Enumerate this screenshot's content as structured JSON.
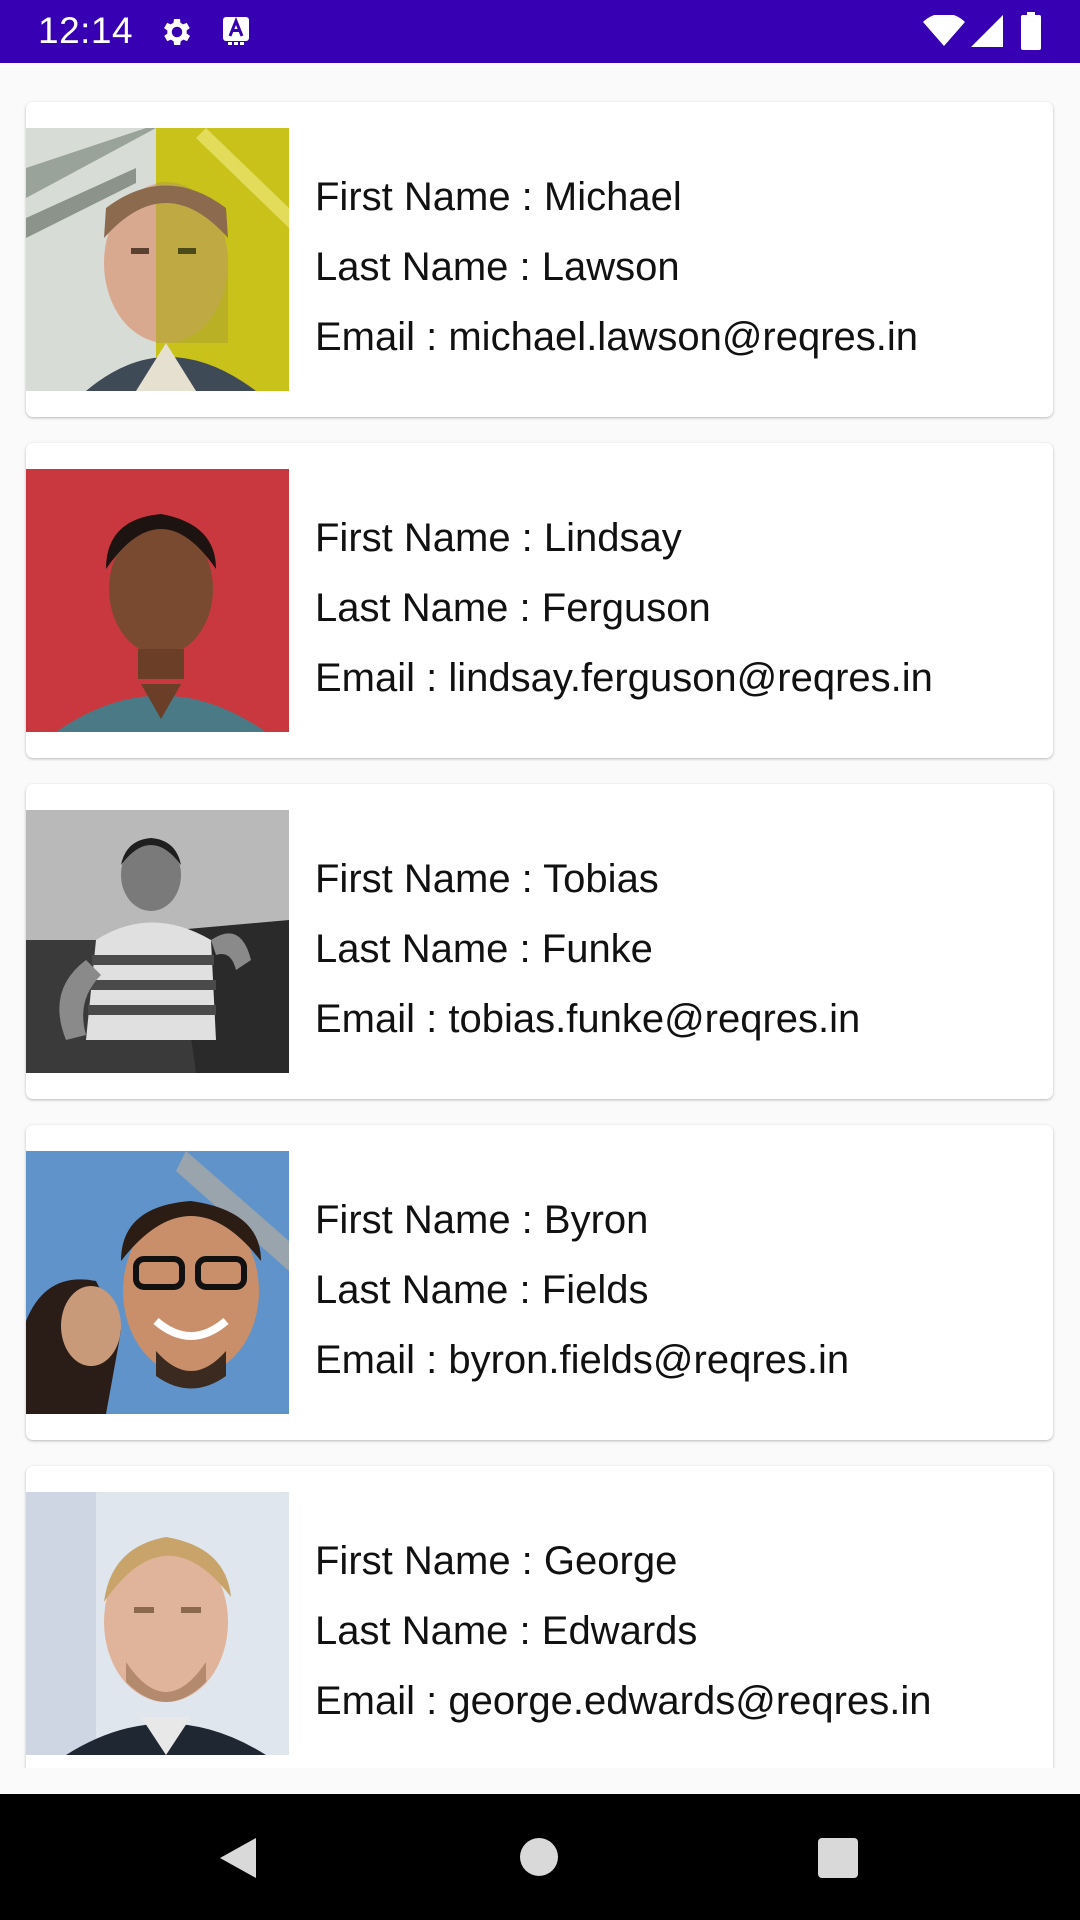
{
  "status_bar": {
    "time": "12:14",
    "background_color": "#3700b3",
    "icons": [
      "gear-icon",
      "keyboard-a-icon",
      "wifi-icon",
      "signal-icon",
      "battery-icon"
    ]
  },
  "users": [
    {
      "first_name_label": "First Name : Michael",
      "last_name_label": "Last Name : Lawson",
      "email_label": "Email : michael.lawson@reqres.in",
      "avatar": "michael-lawson-avatar"
    },
    {
      "first_name_label": "First Name : Lindsay",
      "last_name_label": "Last Name : Ferguson",
      "email_label": "Email : lindsay.ferguson@reqres.in",
      "avatar": "lindsay-ferguson-avatar"
    },
    {
      "first_name_label": "First Name : Tobias",
      "last_name_label": "Last Name : Funke",
      "email_label": "Email : tobias.funke@reqres.in",
      "avatar": "tobias-funke-avatar"
    },
    {
      "first_name_label": "First Name : Byron",
      "last_name_label": "Last Name : Fields",
      "email_label": "Email : byron.fields@reqres.in",
      "avatar": "byron-fields-avatar"
    },
    {
      "first_name_label": "First Name : George",
      "last_name_label": "Last Name : Edwards",
      "email_label": "Email : george.edwards@reqres.in",
      "avatar": "george-edwards-avatar"
    }
  ],
  "nav_bar": {
    "icons": [
      "back-icon",
      "home-icon",
      "recents-icon"
    ]
  }
}
